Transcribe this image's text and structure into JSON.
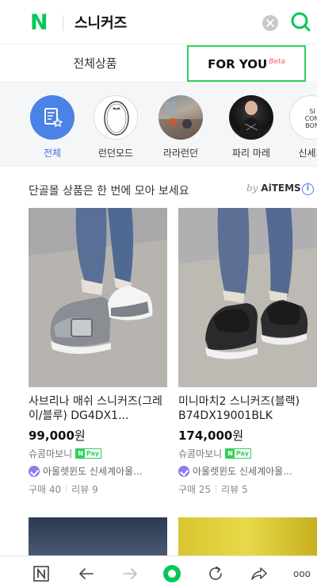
{
  "search": {
    "query": "스니커즈"
  },
  "tabs": [
    {
      "label": "전체상품"
    },
    {
      "label": "FOR YOU",
      "badge": "Beta"
    }
  ],
  "malls": [
    {
      "label": "전체",
      "active": true
    },
    {
      "label": "런던모드",
      "logo_text": "LONDON MODE"
    },
    {
      "label": "라라런던"
    },
    {
      "label": "파리 마레"
    },
    {
      "label": "신세계",
      "logo_text": "SI COM BON"
    }
  ],
  "section": {
    "title": "단골몰 상품은 한 번에 모아 보세요",
    "by": "by",
    "brand": "AiTEMS",
    "info": "i"
  },
  "products": [
    {
      "name": "사브리나 매쉬 스니커즈(그레이/블루) DG4DX1...",
      "price": "99,000",
      "currency": "원",
      "seller": "슈콤마보니",
      "mall": "아울렛윈도 신세계아울...",
      "purchases": "구매 40",
      "reviews": "리뷰 9"
    },
    {
      "name": "미니마치2 스니커즈(블랙) B74DX19001BLK",
      "price": "174,000",
      "currency": "원",
      "seller": "슈콤마보니",
      "mall": "아울렛윈도 신세계아울...",
      "purchases": "구매 25",
      "reviews": "리뷰 5"
    }
  ],
  "npay": {
    "n": "N",
    "pay": "Pay"
  },
  "logo": {
    "letter": "N"
  },
  "toolbar": {
    "items": [
      "naver-home-icon",
      "back-icon",
      "forward-icon",
      "green-dot-icon",
      "refresh-icon",
      "share-icon",
      "more-icon"
    ],
    "more_label": "ooo"
  },
  "colors": {
    "brand": "#03c75a",
    "active_tab_border": "#2ed15a",
    "accent_blue": "#4a82e6",
    "beta_red": "#ff5a5a"
  }
}
